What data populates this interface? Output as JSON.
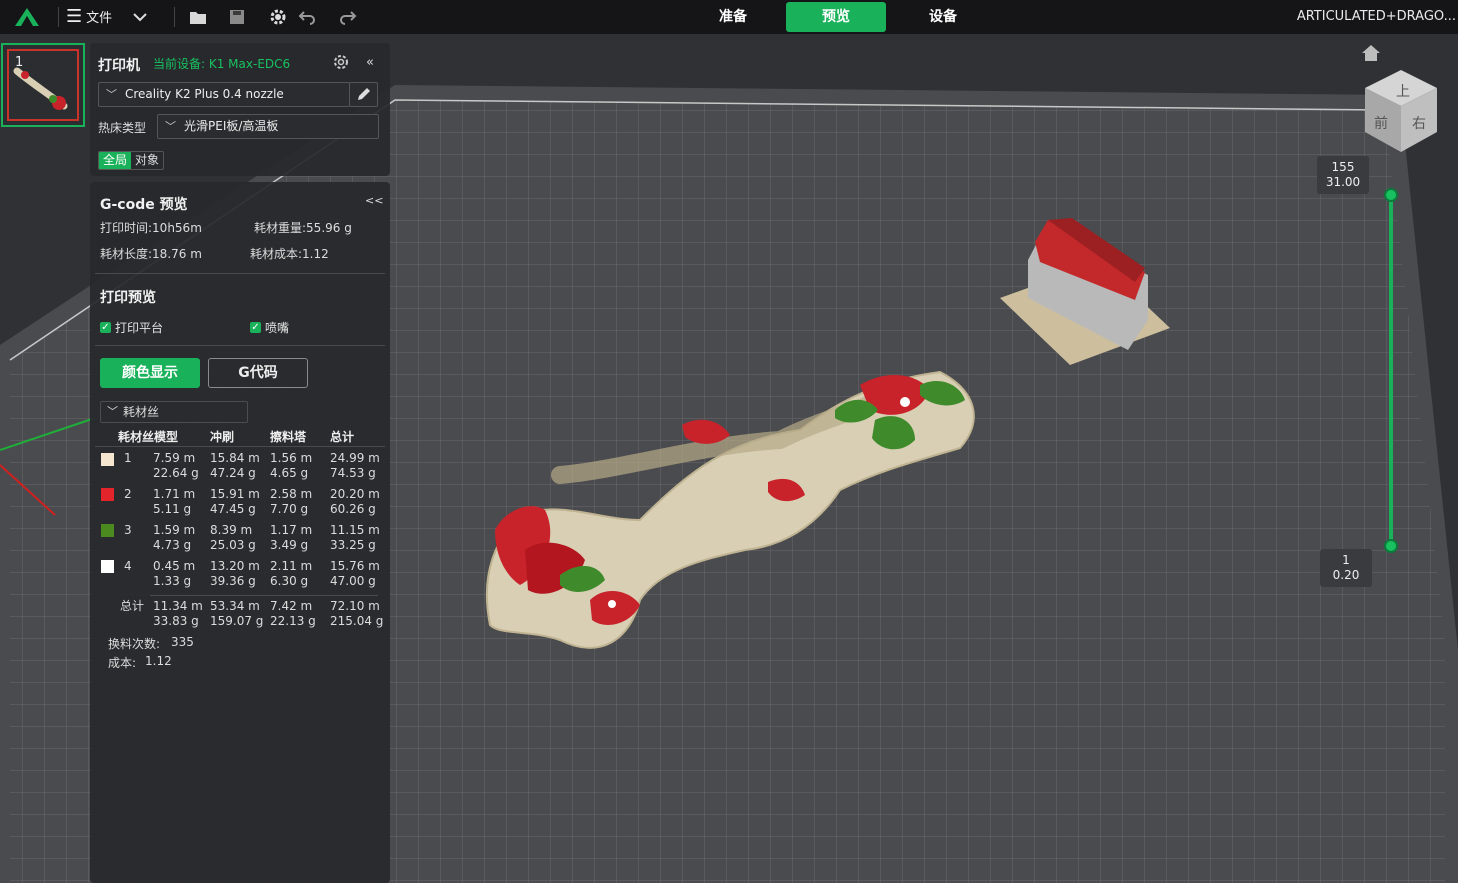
{
  "topbar": {
    "file_menu_label": "文件",
    "tabs": [
      {
        "label": "准备",
        "active": false
      },
      {
        "label": "预览",
        "active": true
      },
      {
        "label": "设备",
        "active": false
      }
    ],
    "project_title": "ARTICULATED+DRAGO...",
    "icons": [
      "logo-icon",
      "menu-icon",
      "chevron-down-icon",
      "open-folder-icon",
      "save-icon",
      "gear-icon",
      "undo-icon",
      "redo-icon"
    ],
    "accent_color": "#19b15a"
  },
  "object_list": {
    "thumbnail_index": "1"
  },
  "printer_panel": {
    "title": "打印机",
    "current_device": "当前设备: K1 Max-EDC6",
    "printer_profile": "Creality K2 Plus 0.4 nozzle",
    "bed_type_label": "热床类型",
    "bed_type_value": "光滑PEI板/高温板",
    "scope_global": "全局",
    "scope_object": "对象",
    "collapse": "«"
  },
  "gcode_panel": {
    "title": "G-code 预览",
    "collapse": "<<",
    "print_time": "打印时间:10h56m",
    "filament_weight": "耗材重量:55.96 g",
    "filament_length": "耗材长度:18.76 m",
    "filament_cost": "耗材成本:1.12",
    "preview_title": "打印预览",
    "show_bed": "打印平台",
    "show_nozzle": "喷嘴",
    "btn_color_view": "颜色显示",
    "btn_gcode": "G代码",
    "view_type": "耗材丝",
    "table": {
      "headers": [
        "耗材丝模型",
        "冲刷",
        "擦料塔",
        "总计"
      ],
      "rows": [
        {
          "swatch": "#f4e6cf",
          "id": "1",
          "model_len": "7.59 m",
          "model_wt": "22.64 g",
          "flush_len": "15.84 m",
          "flush_wt": "47.24 g",
          "tower_len": "1.56 m",
          "tower_wt": "4.65 g",
          "total_len": "24.99 m",
          "total_wt": "74.53 g"
        },
        {
          "swatch": "#e3242b",
          "id": "2",
          "model_len": "1.71 m",
          "model_wt": "5.11 g",
          "flush_len": "15.91 m",
          "flush_wt": "47.45 g",
          "tower_len": "2.58 m",
          "tower_wt": "7.70 g",
          "total_len": "20.20 m",
          "total_wt": "60.26 g"
        },
        {
          "swatch": "#4a8a1e",
          "id": "3",
          "model_len": "1.59 m",
          "model_wt": "4.73 g",
          "flush_len": "8.39 m",
          "flush_wt": "25.03 g",
          "tower_len": "1.17 m",
          "tower_wt": "3.49 g",
          "total_len": "11.15 m",
          "total_wt": "33.25 g"
        },
        {
          "swatch": "#ffffff",
          "id": "4",
          "model_len": "0.45 m",
          "model_wt": "1.33 g",
          "flush_len": "13.20 m",
          "flush_wt": "39.36 g",
          "tower_len": "2.11 m",
          "tower_wt": "6.30 g",
          "total_len": "15.76 m",
          "total_wt": "47.00 g"
        }
      ],
      "total_label": "总计",
      "total": {
        "model_len": "11.34 m",
        "model_wt": "33.83 g",
        "flush_len": "53.34 m",
        "flush_wt": "159.07 g",
        "tower_len": "7.42 m",
        "tower_wt": "22.13 g",
        "total_len": "72.10 m",
        "total_wt": "215.04 g"
      }
    },
    "changes_label": "换料次数:",
    "changes_value": "335",
    "cost_label": "成本:",
    "cost_value": "1.12"
  },
  "layer_slider": {
    "top_layer": "155",
    "top_height": "31.00",
    "bottom_layer": "1",
    "bottom_height": "0.20"
  },
  "view_cube": {
    "top": "上",
    "front": "前",
    "right": "右"
  }
}
